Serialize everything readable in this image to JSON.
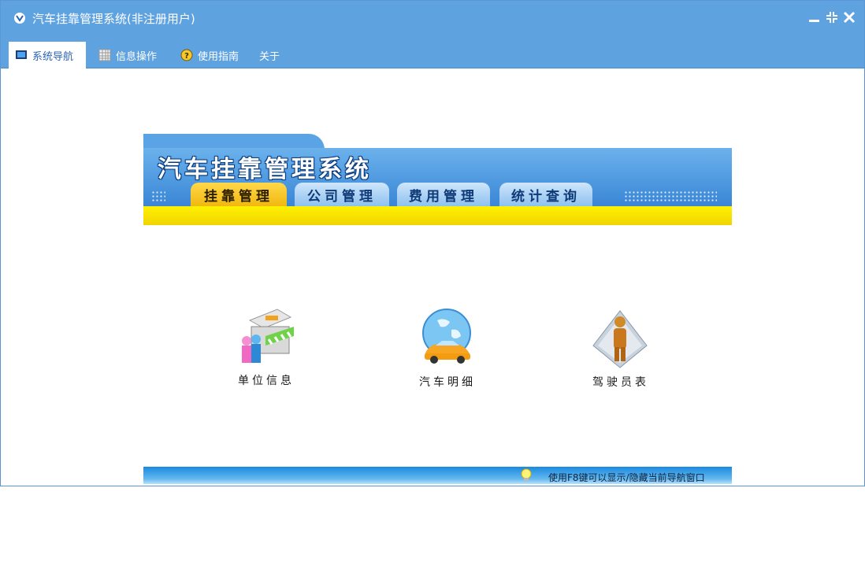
{
  "window": {
    "title": "汽车挂靠管理系统(非注册用户)"
  },
  "menubar": {
    "items": [
      {
        "label": "系统导航",
        "icon": "monitor-icon",
        "active": true
      },
      {
        "label": "信息操作",
        "icon": "grid-icon",
        "active": false
      },
      {
        "label": "使用指南",
        "icon": "help-icon",
        "active": false
      },
      {
        "label": "关于",
        "icon": "",
        "active": false
      }
    ]
  },
  "banner": {
    "title": "汽车挂靠管理系统",
    "tabs": [
      "挂靠管理",
      "公司管理",
      "费用管理",
      "统计查询"
    ]
  },
  "tiles": [
    {
      "label": "单位信息",
      "icon": "shop-people-icon"
    },
    {
      "label": "汽车明细",
      "icon": "globe-car-icon"
    },
    {
      "label": "驾驶员表",
      "icon": "driver-figure-icon"
    }
  ],
  "footer": {
    "hint": "使用F8键可以显示/隐藏当前导航窗口",
    "icon": "lightbulb-icon"
  },
  "colors": {
    "titlebar": "#5fa2e0",
    "accent_yellow": "#fff200",
    "banner_blue": "#3a86d6"
  }
}
